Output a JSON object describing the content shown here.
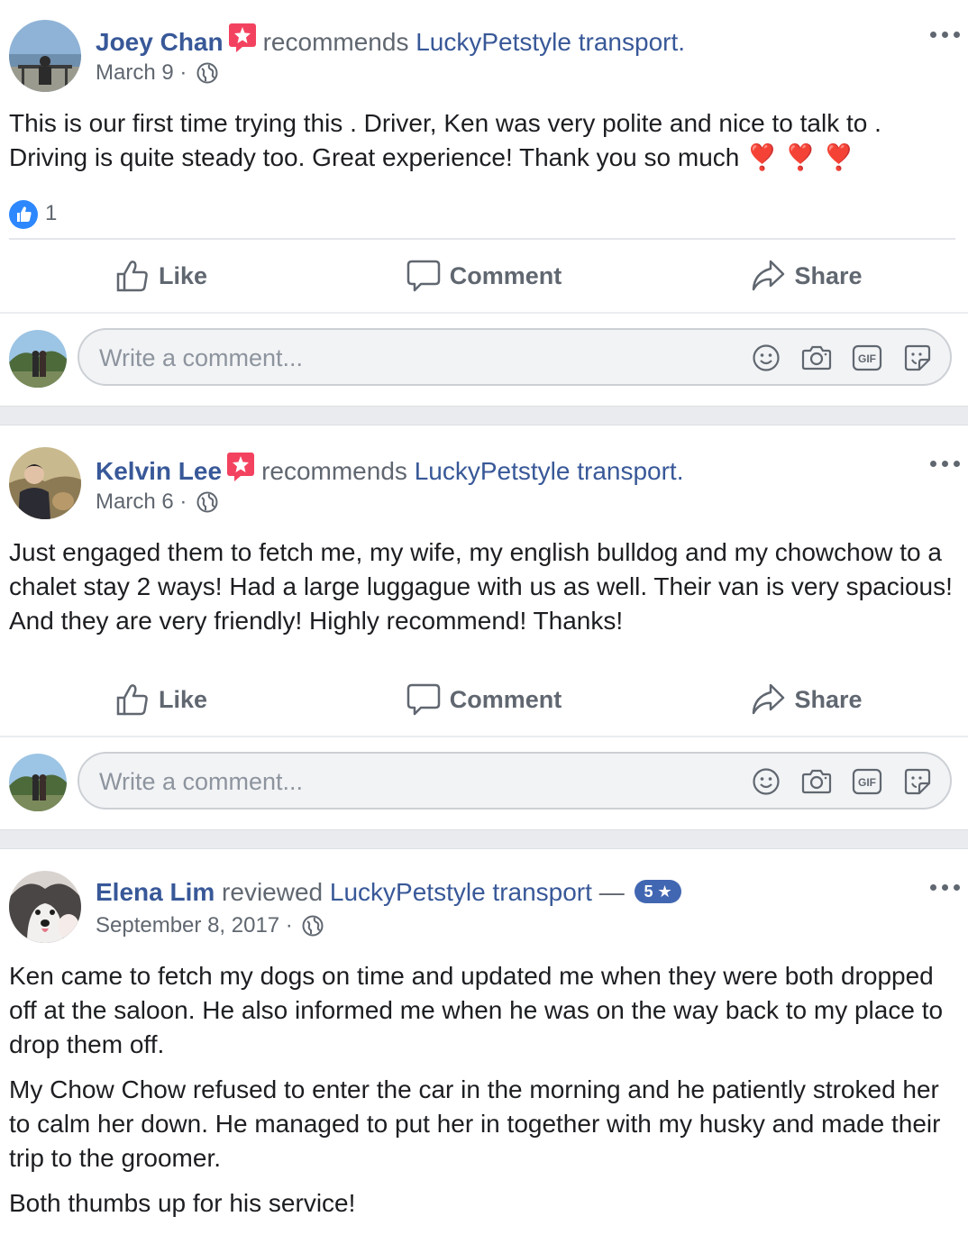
{
  "posts": [
    {
      "author": "Joey Chan",
      "action": "recommends",
      "page": "LuckyPetstyle transport.",
      "date": "March 9 ·",
      "text": [
        "This is our first time trying this . Driver, Ken was very polite and nice to talk to . Driving is quite steady too. Great experience! Thank you so much ❣️ ❣️ ❣️"
      ],
      "like_count": "1",
      "icons": {
        "recommend": "recommend-star-icon",
        "privacy": "globe-icon",
        "more": "more-options-icon"
      }
    },
    {
      "author": "Kelvin Lee",
      "action": "recommends",
      "page": "LuckyPetstyle transport.",
      "date": "March 6 ·",
      "text": [
        "Just engaged them to fetch me, my wife, my english bulldog and my chowchow to a chalet stay 2 ways! Had a large luggague with us as well. Their van is very spacious! And they are very friendly! Highly recommend! Thanks!"
      ]
    },
    {
      "author": "Elena Lim",
      "action": "reviewed",
      "page": "LuckyPetstyle transport",
      "dash": "—",
      "rating": "5 ★",
      "date": "September 8, 2017 ·",
      "text": [
        "Ken came to fetch my dogs on time and updated me when they were both dropped off at the saloon. He also informed me when he was on the way back to my place to drop them off.",
        "My Chow Chow refused to enter the car in the morning and he patiently stroked her to calm her down. He managed to put her in together with my husky and made their trip to the groomer.",
        "Both thumbs up for his service!"
      ]
    }
  ],
  "actions": {
    "like": "Like",
    "comment": "Comment",
    "share": "Share"
  },
  "composer": {
    "placeholder": "Write a comment...",
    "icons": [
      "emoji-icon",
      "camera-icon",
      "gif-icon",
      "sticker-icon"
    ]
  },
  "colors": {
    "link": "#385898",
    "meta": "#606770",
    "separator": "#e9ebee",
    "like_blue": "#2d88ff",
    "recommend_red": "#f3425f"
  }
}
